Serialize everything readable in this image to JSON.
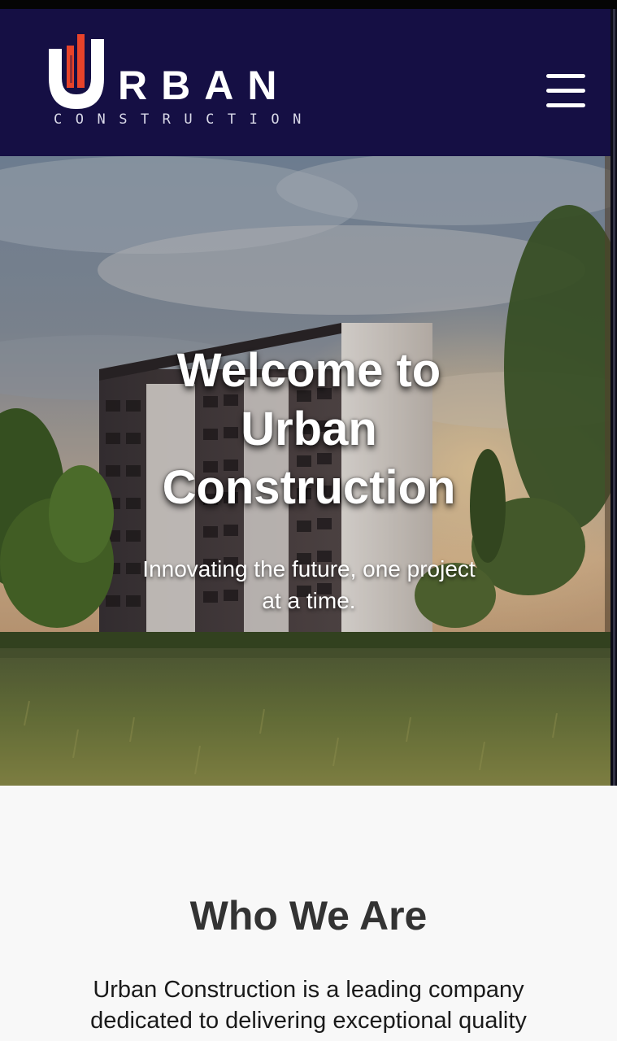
{
  "header": {
    "logo_wordmark": "RBAN",
    "logo_subtitle": "CONSTRUCTION",
    "menu_icon": "hamburger-menu-icon",
    "background_color": "#150f44",
    "logo_accent_color": "#e8432a"
  },
  "hero": {
    "title": "Welcome to Urban Construction",
    "subtitle": "Innovating the future, one project at a time."
  },
  "about": {
    "heading": "Who We Are",
    "body": "Urban Construction is a leading company dedicated to delivering exceptional quality"
  }
}
